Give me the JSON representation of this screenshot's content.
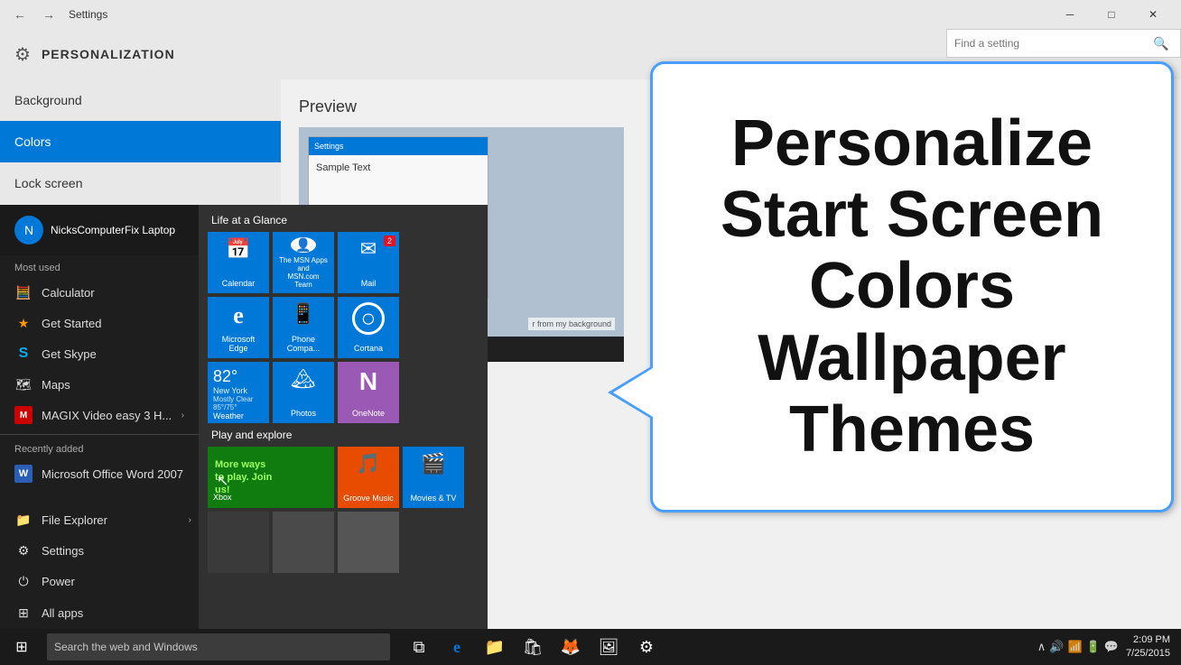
{
  "titlebar": {
    "title": "Settings",
    "back_label": "←",
    "forward_label": "→",
    "minimize_label": "─",
    "maximize_label": "□",
    "close_label": "✕"
  },
  "settings": {
    "title": "PERSONALIZATION",
    "gear_icon": "⚙"
  },
  "top_search": {
    "placeholder": "Find a setting"
  },
  "sidebar": {
    "items": [
      {
        "label": "Background",
        "active": false
      },
      {
        "label": "Colors",
        "active": true
      },
      {
        "label": "Lock screen",
        "active": false
      }
    ]
  },
  "main": {
    "preview_label": "Preview"
  },
  "start_menu": {
    "user_name": "NicksComputerFix Laptop",
    "user_initial": "N",
    "most_used_label": "Most used",
    "apps": [
      {
        "icon": "🧮",
        "label": "Calculator"
      },
      {
        "icon": "★",
        "label": "Get Started"
      },
      {
        "icon": "S",
        "label": "Get Skype"
      },
      {
        "icon": "🗺",
        "label": "Maps"
      },
      {
        "icon": "M",
        "label": "MAGIX Video easy 3 H...",
        "arrow": true
      }
    ],
    "recently_added_label": "Recently added",
    "recent_apps": [
      {
        "icon": "W",
        "label": "Microsoft Office Word 2007"
      }
    ],
    "bottom_items": [
      {
        "icon": "📁",
        "label": "File Explorer",
        "arrow": true
      },
      {
        "icon": "⚙",
        "label": "Settings"
      },
      {
        "icon": "⏻",
        "label": "Power"
      }
    ],
    "all_apps_label": "All apps",
    "life_at_glance_label": "Life at a Glance",
    "play_explore_label": "Play and explore",
    "tiles": {
      "top_row": [
        {
          "id": "calendar",
          "label": "Calendar",
          "icon": "📅",
          "color": "#0078d7",
          "size": "small"
        },
        {
          "id": "msn",
          "label": "",
          "size": "small"
        },
        {
          "id": "mail",
          "label": "Mail",
          "icon": "✉",
          "color": "#0078d7",
          "size": "small",
          "badge": "2"
        }
      ],
      "middle_row": [
        {
          "id": "edge",
          "label": "Microsoft Edge",
          "icon": "e",
          "color": "#0078d7",
          "size": "small"
        },
        {
          "id": "phone",
          "label": "Phone Compa...",
          "icon": "📱",
          "color": "#0078d7",
          "size": "small"
        },
        {
          "id": "cortana",
          "label": "Cortana",
          "icon": "○",
          "color": "#0078d7",
          "size": "small"
        }
      ],
      "weather_row": [
        {
          "id": "weather",
          "label": "Weather",
          "temp": "82°",
          "city": "New York",
          "desc": "Mostly Clear",
          "range": "85°/75°",
          "color": "#0078d7",
          "size": "small"
        },
        {
          "id": "photos",
          "label": "Photos",
          "icon": "🏔",
          "color": "#0078d7",
          "size": "small"
        },
        {
          "id": "onenote",
          "label": "OneNote",
          "icon": "N",
          "color": "#9b59b6",
          "size": "small"
        }
      ],
      "bottom_row": [
        {
          "id": "xbox",
          "label": "Xbox",
          "size": "wide",
          "promo": "More ways\nto play. Join\nus!"
        },
        {
          "id": "groove",
          "label": "Groove Music",
          "icon": "🎵",
          "color": "#e84c00",
          "size": "small"
        },
        {
          "id": "movies",
          "label": "Movies & TV",
          "icon": "🎬",
          "color": "#0078d7",
          "size": "small"
        }
      ],
      "dark_tiles": [
        {
          "id": "dark1",
          "color": "#3a3a3a"
        },
        {
          "id": "dark2",
          "color": "#4a4a4a"
        },
        {
          "id": "dark3",
          "color": "#555"
        }
      ]
    }
  },
  "annotation": {
    "line1": "Personalize",
    "line2": "Start Screen",
    "line3": "Colors",
    "line4": "Wallpaper",
    "line5": "Themes"
  },
  "taskbar": {
    "search_placeholder": "Search the web and Windows",
    "time": "2:09 PM",
    "date": "7/25/2015",
    "start_icon": "⊞"
  },
  "preview": {
    "sample_text": "Sample Text",
    "color_text": "r from my background"
  }
}
